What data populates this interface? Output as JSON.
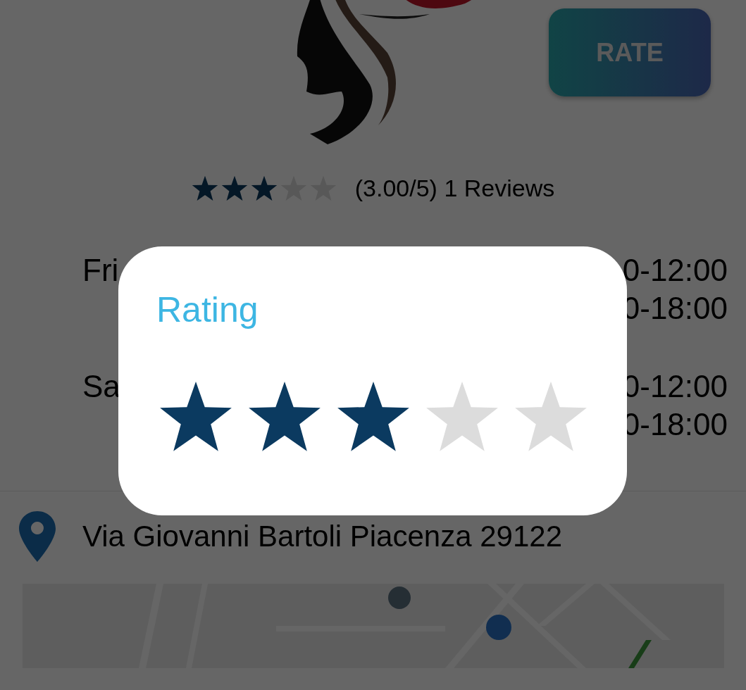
{
  "header": {
    "rate_button": "RATE"
  },
  "summary": {
    "stars": 3,
    "text": "(3.00/5) 1 Reviews"
  },
  "hours": [
    {
      "day": "Fri",
      "times": [
        "0-12:00",
        "0-18:00"
      ]
    },
    {
      "day": "Sa",
      "times": [
        "0-12:00",
        "0-18:00"
      ]
    }
  ],
  "address": "Via Giovanni Bartoli Piacenza 29122",
  "dialog": {
    "title": "Rating",
    "stars": 3
  }
}
